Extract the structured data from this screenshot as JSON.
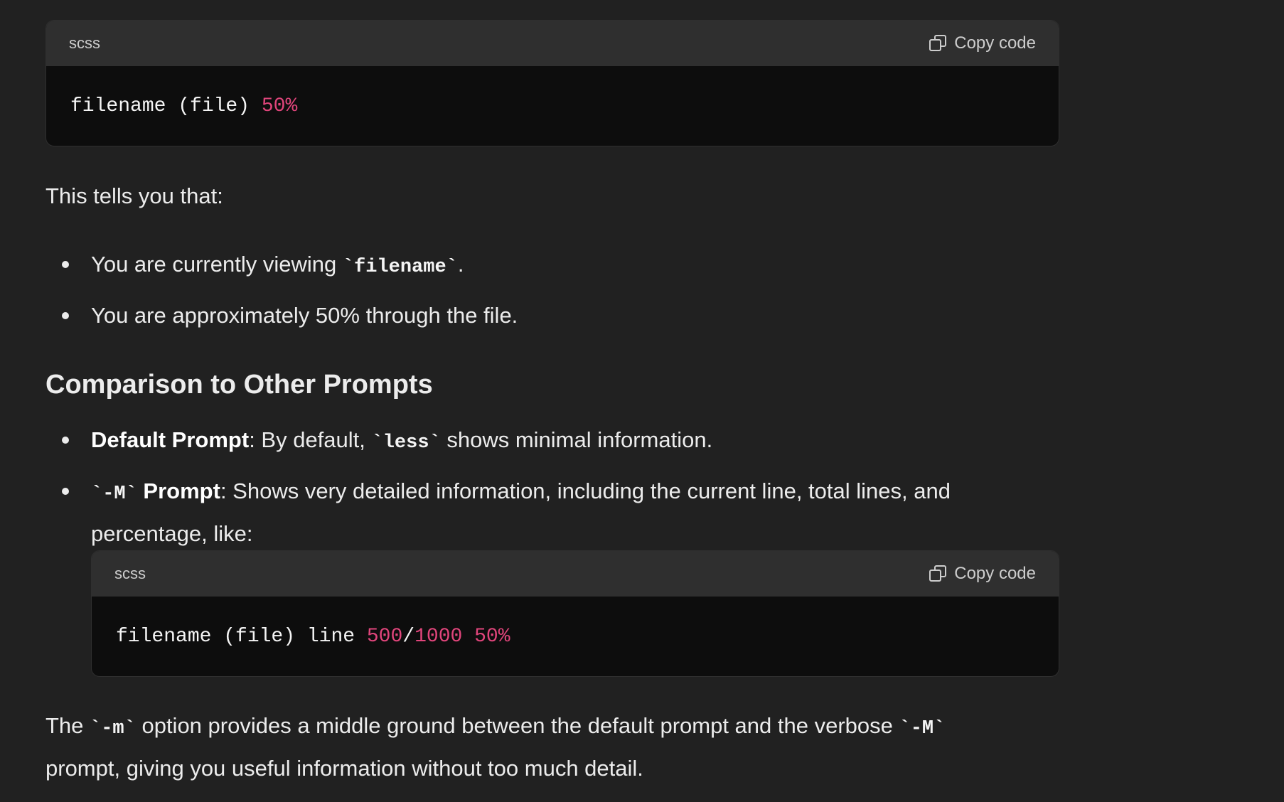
{
  "code_block_1": {
    "lang": "scss",
    "copy_label": "Copy code",
    "code_text": "filename (file) ",
    "code_num": "50%"
  },
  "intro_text": "This tells you that:",
  "list1": {
    "item1_pre": "You are currently viewing ",
    "item1_code": "`filename`",
    "item1_post": ".",
    "item2": "You are approximately 50% through the file."
  },
  "heading": "Comparison to Other Prompts",
  "list2": {
    "item1_bold": "Default Prompt",
    "item1_pre": ": By default, ",
    "item1_code": "`less`",
    "item1_post": " shows minimal information.",
    "item2_code": "`-M`",
    "item2_bold": " Prompt",
    "item2_line1": ": Shows very detailed information, including the current line, total lines, and",
    "item2_line2": "percentage, like:"
  },
  "code_block_2": {
    "lang": "scss",
    "copy_label": "Copy code",
    "code_text": "filename (file) line ",
    "num1": "500",
    "slash": "/",
    "num2": "1000",
    "space": " ",
    "num3": "50%"
  },
  "final": {
    "pre": "The ",
    "code1": "`-m`",
    "mid": " option provides a middle ground between the default prompt and the verbose ",
    "code2": "`-M`",
    "line2": "prompt, giving you useful information without too much detail."
  },
  "colors": {
    "background": "#212121",
    "code_header": "#2f2f2f",
    "code_body": "#0d0d0d",
    "number": "#e0457b"
  }
}
